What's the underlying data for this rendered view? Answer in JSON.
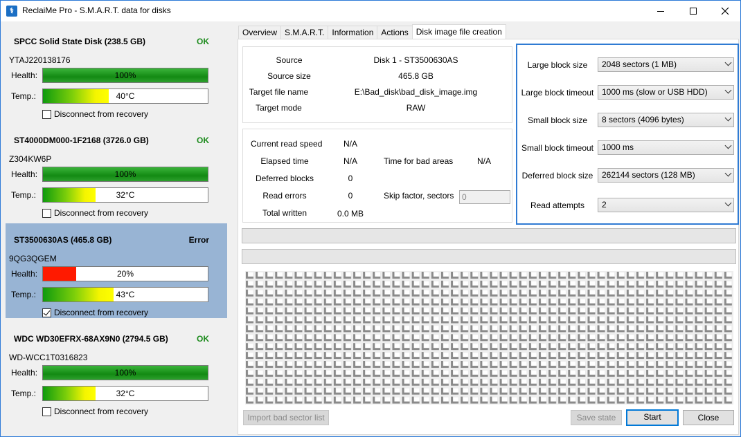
{
  "window": {
    "title": "ReclaiMe Pro - S.M.A.R.T. data for disks"
  },
  "disks": [
    {
      "name": "SPCC Solid State Disk (238.5 GB)",
      "status": "OK",
      "serial": "YTAJ220138176",
      "health_label": "Health:",
      "health_text": "100%",
      "health_percent": 100,
      "temp_label": "Temp.:",
      "temp_text": "40°C",
      "temp_fraction": 0.4,
      "disconnect_label": "Disconnect from recovery",
      "disconnect_checked": false
    },
    {
      "name": "ST4000DM000-1F2168 (3726.0 GB)",
      "status": "OK",
      "serial": "Z304KW6P",
      "health_label": "Health:",
      "health_text": "100%",
      "health_percent": 100,
      "temp_label": "Temp.:",
      "temp_text": "32°C",
      "temp_fraction": 0.32,
      "disconnect_label": "Disconnect from recovery",
      "disconnect_checked": false
    },
    {
      "name": "ST3500630AS (465.8 GB)",
      "status": "Error",
      "serial": "9QG3QGEM",
      "health_label": "Health:",
      "health_text": "20%",
      "health_percent": 20,
      "temp_label": "Temp.:",
      "temp_text": "43°C",
      "temp_fraction": 0.43,
      "disconnect_label": "Disconnect from recovery",
      "disconnect_checked": true
    },
    {
      "name": "WDC WD30EFRX-68AX9N0 (2794.5 GB)",
      "status": "OK",
      "serial": "WD-WCC1T0316823",
      "health_label": "Health:",
      "health_text": "100%",
      "health_percent": 100,
      "temp_label": "Temp.:",
      "temp_text": "32°C",
      "temp_fraction": 0.32,
      "disconnect_label": "Disconnect from recovery",
      "disconnect_checked": false
    }
  ],
  "tabs": [
    "Overview",
    "S.M.A.R.T.",
    "Information",
    "Actions",
    "Disk image file creation"
  ],
  "info": {
    "source_label": "Source",
    "source_value": "Disk 1 - ST3500630AS",
    "source_size_label": "Source size",
    "source_size_value": "465.8 GB",
    "target_file_label": "Target file name",
    "target_file_value": "E:\\Bad_disk\\bad_disk_image.img",
    "target_mode_label": "Target mode",
    "target_mode_value": "RAW"
  },
  "stats": {
    "read_speed_label": "Current read speed",
    "read_speed_value": "N/A",
    "elapsed_label": "Elapsed time",
    "elapsed_value": "N/A",
    "bad_areas_label": "Time for bad areas",
    "bad_areas_value": "N/A",
    "deferred_label": "Deferred blocks",
    "deferred_value": "0",
    "read_errors_label": "Read errors",
    "read_errors_value": "0",
    "skip_label": "Skip factor, sectors",
    "skip_placeholder": "0",
    "total_written_label": "Total written",
    "total_written_value": "0.0 MB"
  },
  "settings": {
    "large_block_size_label": "Large block size",
    "large_block_size_value": "2048 sectors (1 MB)",
    "large_block_timeout_label": "Large block timeout",
    "large_block_timeout_value": "1000 ms (slow or USB HDD)",
    "small_block_size_label": "Small block size",
    "small_block_size_value": "8 sectors (4096 bytes)",
    "small_block_timeout_label": "Small block timeout",
    "small_block_timeout_value": "1000 ms",
    "deferred_block_size_label": "Deferred block size",
    "deferred_block_size_value": "262144 sectors (128 MB)",
    "read_attempts_label": "Read attempts",
    "read_attempts_value": "2"
  },
  "buttons": {
    "import_bad_sector": "Import bad sector list",
    "save_state": "Save state",
    "start": "Start",
    "close": "Close"
  },
  "icons": {
    "app": "reclaime-app-icon",
    "minimize": "minimize-icon",
    "maximize": "maximize-icon",
    "close": "close-icon"
  }
}
